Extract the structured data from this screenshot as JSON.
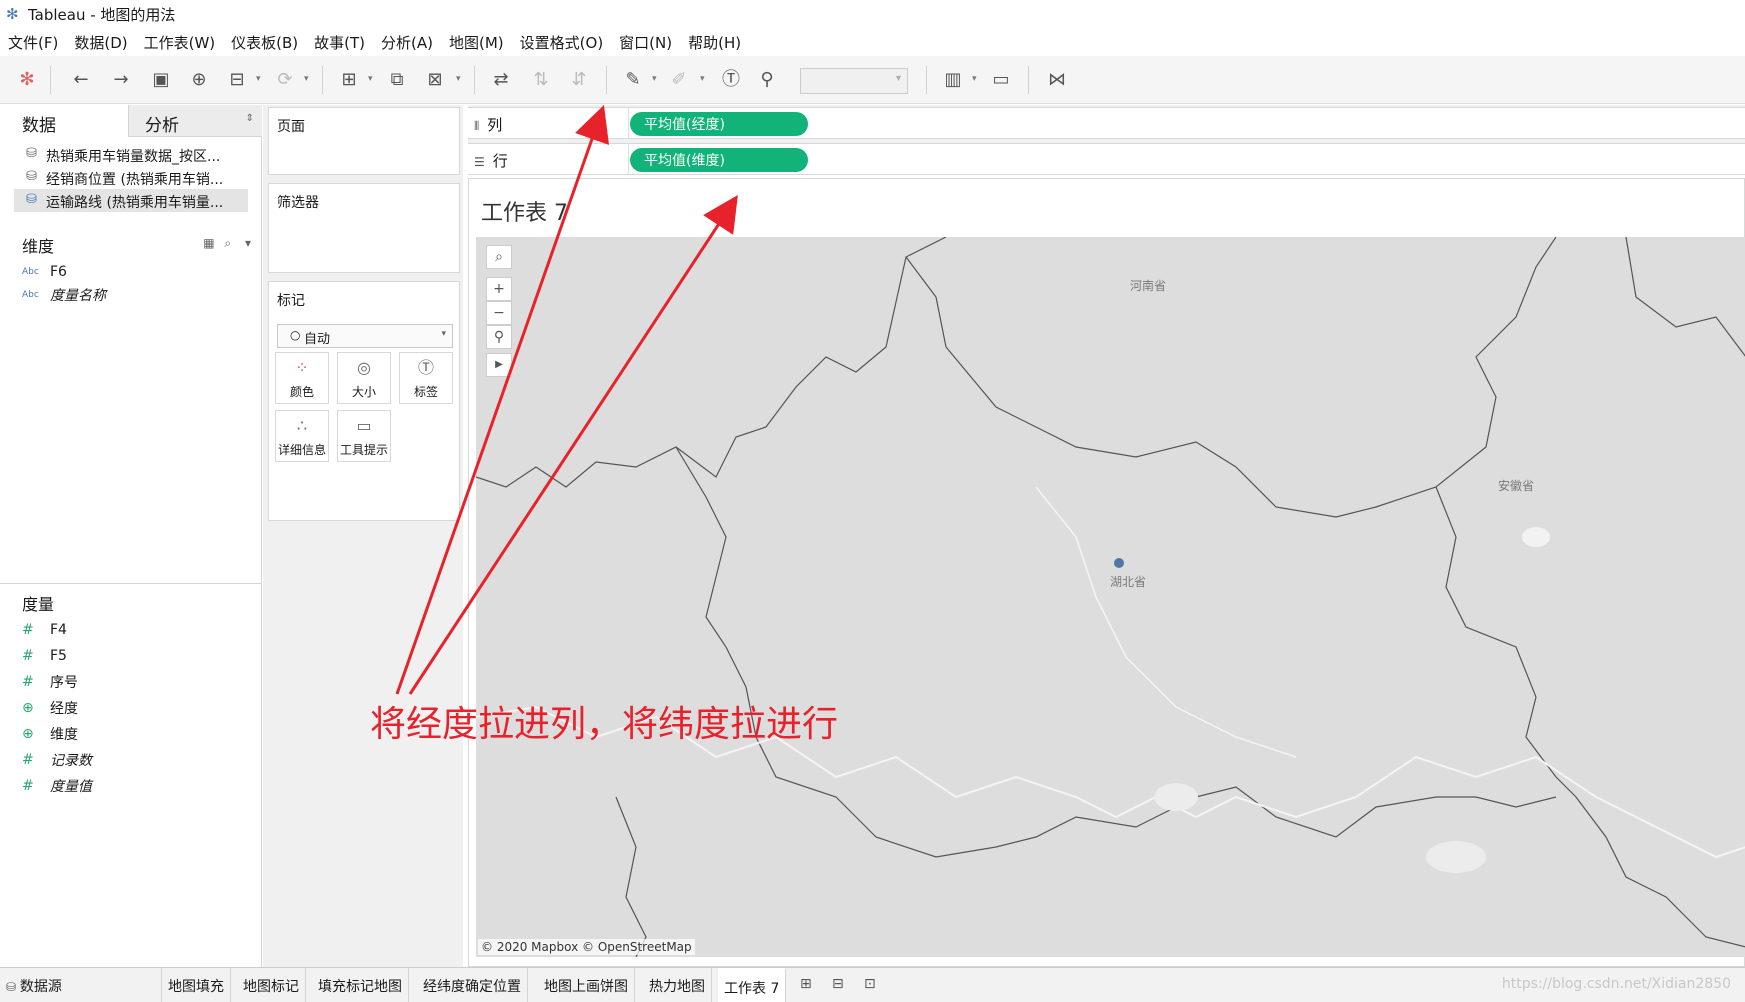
{
  "window": {
    "title": "Tableau - 地图的用法"
  },
  "menu": [
    "文件(F)",
    "数据(D)",
    "工作表(W)",
    "仪表板(B)",
    "故事(T)",
    "分析(A)",
    "地图(M)",
    "设置格式(O)",
    "窗口(N)",
    "帮助(H)"
  ],
  "toolbar": {
    "icons": [
      "tableau-logo-icon",
      "undo-icon",
      "redo-icon",
      "save-icon",
      "new-datasource-icon",
      "pause-updates-icon",
      "refresh-icon",
      "new-worksheet-icon",
      "duplicate-sheet-icon",
      "clear-sheet-icon",
      "swap-icon",
      "sort-asc-icon",
      "sort-desc-icon",
      "highlight-icon",
      "group-icon",
      "label-icon",
      "pin-icon",
      "fit-combo",
      "show-me-icon",
      "presentation-icon",
      "share-icon"
    ]
  },
  "left_pane": {
    "tab_data": "数据",
    "tab_analysis": "分析",
    "datasources": [
      {
        "label": "热销乘用车销量数据_按区...",
        "active": false
      },
      {
        "label": "经销商位置 (热销乘用车销...",
        "active": false
      },
      {
        "label": "运输路线 (热销乘用车销量...",
        "active": true
      }
    ],
    "dimensions_title": "维度",
    "dimensions": [
      {
        "type": "Abc",
        "name": "F6",
        "italic": false
      },
      {
        "type": "Abc",
        "name": "度量名称",
        "italic": true
      }
    ],
    "measures_title": "度量",
    "measures": [
      {
        "type": "#",
        "name": "F4",
        "italic": false
      },
      {
        "type": "#",
        "name": "F5",
        "italic": false
      },
      {
        "type": "#",
        "name": "序号",
        "italic": false
      },
      {
        "type": "globe",
        "name": "经度",
        "italic": false
      },
      {
        "type": "globe",
        "name": "维度",
        "italic": false
      },
      {
        "type": "#",
        "name": "记录数",
        "italic": true
      },
      {
        "type": "#",
        "name": "度量值",
        "italic": true
      }
    ]
  },
  "cards": {
    "pages": "页面",
    "filters": "筛选器",
    "marks": "标记",
    "mark_type": "自动",
    "mark_buttons": [
      "颜色",
      "大小",
      "标签",
      "详细信息",
      "工具提示"
    ]
  },
  "shelves": {
    "columns_label": "列",
    "columns_pill": "平均值(经度)",
    "rows_label": "行",
    "rows_pill": "平均值(维度)"
  },
  "view": {
    "sheet_title": "工作表 7",
    "provinces": [
      "河南省",
      "安徽省",
      "湖北省"
    ],
    "attribution": "© 2020 Mapbox © OpenStreetMap",
    "annotation": "将经度拉进列，将纬度拉进行",
    "colors": {
      "pill": "#11b379",
      "mark": "#4e79a7",
      "annotation": "#e8222b"
    }
  },
  "tabs": {
    "datasource": "数据源",
    "sheets": [
      "地图填充",
      "地图标记",
      "填充标记地图",
      "经纬度确定位置",
      "地图上画饼图",
      "热力地图",
      "工作表 7"
    ],
    "active": "工作表 7"
  },
  "watermark": "https://blog.csdn.net/Xidian2850"
}
